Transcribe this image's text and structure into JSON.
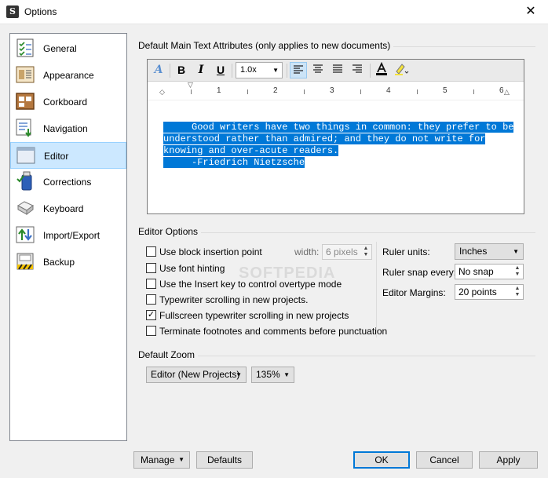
{
  "window": {
    "title": "Options",
    "close": "✕"
  },
  "sidebar": {
    "items": [
      {
        "label": "General",
        "icon": "checklist-icon"
      },
      {
        "label": "Appearance",
        "icon": "appearance-icon"
      },
      {
        "label": "Corkboard",
        "icon": "corkboard-icon"
      },
      {
        "label": "Navigation",
        "icon": "navigation-icon"
      },
      {
        "label": "Editor",
        "icon": "editor-icon",
        "selected": true
      },
      {
        "label": "Corrections",
        "icon": "corrections-icon"
      },
      {
        "label": "Keyboard",
        "icon": "keyboard-icon"
      },
      {
        "label": "Import/Export",
        "icon": "import-export-icon"
      },
      {
        "label": "Backup",
        "icon": "backup-icon"
      }
    ]
  },
  "text_attributes": {
    "title": "Default Main Text Attributes (only applies to new documents)",
    "toolbar": {
      "bold": "B",
      "italic": "I",
      "underline": "U",
      "line_spacing": "1.0x"
    },
    "ruler_numbers": [
      "1",
      "2",
      "3",
      "4",
      "5",
      "6"
    ],
    "sample_lines": [
      "     Good writers have two things in common: they prefer to be",
      "understood rather than admired; and they do not write for",
      "knowing and over-acute readers.",
      "     -Friedrich Nietzsche"
    ]
  },
  "editor_options": {
    "title": "Editor Options",
    "checkboxes": [
      {
        "label": "Use block insertion point",
        "checked": false
      },
      {
        "label": "Use font hinting",
        "checked": false
      },
      {
        "label": "Use the Insert key to control overtype mode",
        "checked": false
      },
      {
        "label": "Typewriter scrolling in new projects.",
        "checked": false
      },
      {
        "label": "Fullscreen typewriter scrolling in new projects",
        "checked": true
      },
      {
        "label": "Terminate footnotes and comments before punctuation",
        "checked": false
      }
    ],
    "width_label": "width:",
    "width_value": "6 pixels",
    "ruler_units_label": "Ruler units:",
    "ruler_units_value": "Inches",
    "ruler_snap_label": "Ruler snap every:",
    "ruler_snap_value": "No snap",
    "editor_margins_label": "Editor Margins:",
    "editor_margins_value": "20 points"
  },
  "zoom": {
    "title": "Default Zoom",
    "target": "Editor (New Projects)",
    "value": "135%"
  },
  "buttons": {
    "manage": "Manage",
    "defaults": "Defaults",
    "ok": "OK",
    "cancel": "Cancel",
    "apply": "Apply"
  },
  "watermark": "SOFTPEDIA",
  "colors": {
    "selection": "#0078d7",
    "sidebar_selected": "#cce8ff",
    "accent": "#0078d7"
  }
}
